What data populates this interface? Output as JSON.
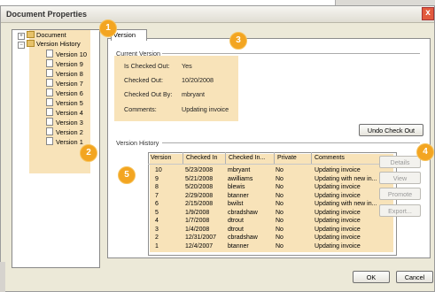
{
  "dialog": {
    "title": "Document Properties",
    "close_glyph": "x"
  },
  "tree": {
    "root_label": "Document",
    "history_label": "Version History",
    "versions": [
      "Version 10",
      "Version 9",
      "Version 8",
      "Version 7",
      "Version 6",
      "Version 5",
      "Version 4",
      "Version 3",
      "Version 2",
      "Version 1"
    ],
    "expand_glyph": "+",
    "collapse_glyph": "−"
  },
  "tabs": {
    "active": "Version"
  },
  "current_version": {
    "section_label": "Current Version",
    "rows": [
      {
        "label": "Is Checked Out:",
        "value": "Yes"
      },
      {
        "label": "Checked Out:",
        "value": "10/20/2008"
      },
      {
        "label": "Checked Out By:",
        "value": "mbryant"
      },
      {
        "label": "Comments:",
        "value": "Updating invoice"
      }
    ]
  },
  "buttons": {
    "undo_check_out": "Undo Check Out",
    "details": "Details",
    "view": "View",
    "promote": "Promote",
    "export": "Export...",
    "ok": "OK",
    "cancel": "Cancel"
  },
  "version_history": {
    "section_label": "Version History",
    "columns": [
      "Version",
      "Checked In",
      "Checked In...",
      "Private",
      "Comments"
    ],
    "rows": [
      {
        "version": "10",
        "checked_in": "5/23/2008",
        "by": "mbryant",
        "private": "No",
        "comments": "Updating invoice"
      },
      {
        "version": "9",
        "checked_in": "5/21/2008",
        "by": "awilliams",
        "private": "No",
        "comments": "Updating with new in..."
      },
      {
        "version": "8",
        "checked_in": "5/20/2008",
        "by": "blewis",
        "private": "No",
        "comments": "Updating invoice"
      },
      {
        "version": "7",
        "checked_in": "2/29/2008",
        "by": "btanner",
        "private": "No",
        "comments": "Updating invoice"
      },
      {
        "version": "6",
        "checked_in": "2/15/2008",
        "by": "bwilst",
        "private": "No",
        "comments": "Updating with new in..."
      },
      {
        "version": "5",
        "checked_in": "1/9/2008",
        "by": "cbradshaw",
        "private": "No",
        "comments": "Updating invoice"
      },
      {
        "version": "4",
        "checked_in": "1/7/2008",
        "by": "dtrout",
        "private": "No",
        "comments": "Updating invoice"
      },
      {
        "version": "3",
        "checked_in": "1/4/2008",
        "by": "dtrout",
        "private": "No",
        "comments": "Updating invoice"
      },
      {
        "version": "2",
        "checked_in": "12/31/2007",
        "by": "cbradshaw",
        "private": "No",
        "comments": "Updating invoice"
      },
      {
        "version": "1",
        "checked_in": "12/4/2007",
        "by": "btanner",
        "private": "No",
        "comments": "Updating invoice"
      }
    ]
  },
  "badges": [
    "1",
    "2",
    "3",
    "4",
    "5"
  ],
  "colors": {
    "highlight": "#f8e3b9",
    "badge": "#f3a521"
  }
}
